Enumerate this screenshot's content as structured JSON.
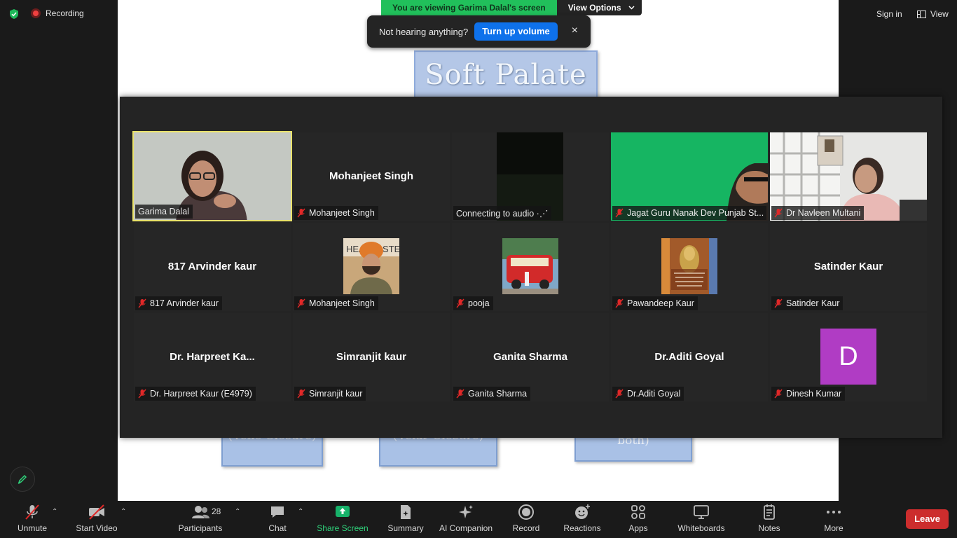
{
  "top_bar": {
    "recording_label": "Recording",
    "viewing_banner": "You are viewing Garima Dalal's screen",
    "view_options_label": "View Options",
    "sign_in_label": "Sign in",
    "view_label": "View"
  },
  "toast": {
    "message": "Not hearing anything?",
    "action_label": "Turn up volume",
    "close_glyph": "×"
  },
  "slide": {
    "title": "Soft Palate",
    "box1": "(Velic Closure)",
    "box2": "(Velar Closure)",
    "box3": "both)"
  },
  "gallery": {
    "tiles": [
      {
        "center_name": "",
        "tag": "Garima Dalal",
        "muted": false
      },
      {
        "center_name": "Mohanjeet Singh",
        "tag": "Mohanjeet Singh",
        "muted": true
      },
      {
        "center_name": "",
        "tag": "Connecting to audio ·⋰",
        "muted": false
      },
      {
        "center_name": "",
        "tag": "Jagat Guru Nanak Dev Punjab St...",
        "muted": true
      },
      {
        "center_name": "",
        "tag": "Dr Navleen Multani",
        "muted": true
      },
      {
        "center_name": "817 Arvinder kaur",
        "tag": "817 Arvinder kaur",
        "muted": true
      },
      {
        "center_name": "",
        "tag": "Mohanjeet Singh",
        "muted": true
      },
      {
        "center_name": "",
        "tag": "pooja",
        "muted": true
      },
      {
        "center_name": "",
        "tag": "Pawandeep Kaur",
        "muted": true
      },
      {
        "center_name": "Satinder Kaur",
        "tag": "Satinder Kaur",
        "muted": true
      },
      {
        "center_name": "Dr. Harpreet Ka...",
        "tag": "Dr. Harpreet Kaur (E4979)",
        "muted": true
      },
      {
        "center_name": "Simranjit kaur",
        "tag": "Simranjit kaur",
        "muted": true
      },
      {
        "center_name": "Ganita Sharma",
        "tag": "Ganita Sharma",
        "muted": true
      },
      {
        "center_name": "Dr.Aditi Goyal",
        "tag": "Dr.Aditi Goyal",
        "muted": true
      },
      {
        "center_name": "",
        "tag": "Dinesh Kumar",
        "muted": true
      }
    ],
    "dinesh_avatar_letter": "D"
  },
  "toolbar": {
    "unmute": "Unmute",
    "start_video": "Start Video",
    "participants": "Participants",
    "participants_count": "28",
    "chat": "Chat",
    "share_screen": "Share Screen",
    "summary": "Summary",
    "ai_companion": "AI Companion",
    "record": "Record",
    "reactions": "Reactions",
    "apps": "Apps",
    "whiteboards": "Whiteboards",
    "notes": "Notes",
    "more": "More",
    "leave": "Leave"
  },
  "colors": {
    "banner_green": "#21c05b",
    "share_green": "#17b26a",
    "leave_red": "#cc2d2d",
    "toast_blue": "#0e71eb",
    "active_speaker": "#e9e26a",
    "avatar_purple": "#b03cc4"
  }
}
